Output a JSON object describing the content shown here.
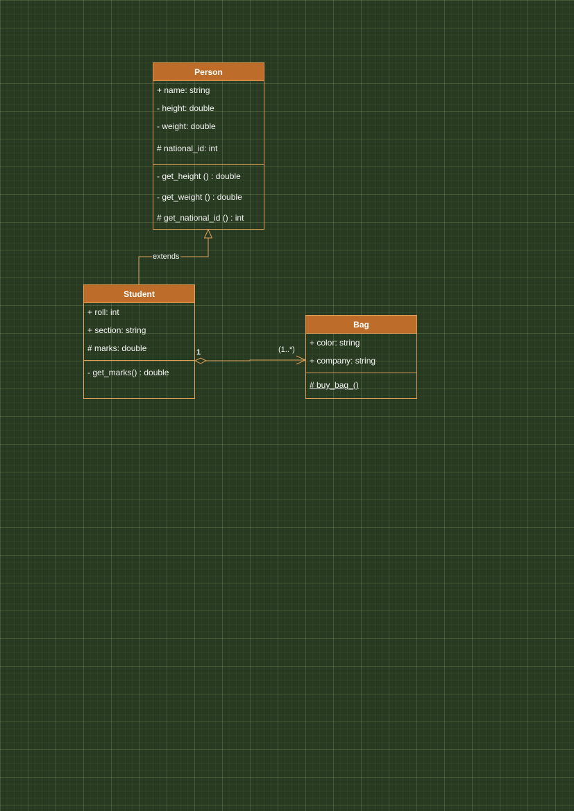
{
  "classes": {
    "person": {
      "name": "Person",
      "attributes": [
        "+ name: string",
        "- height: double",
        "- weight: double",
        "# national_id: int"
      ],
      "methods": [
        "- get_height () : double",
        "- get_weight () : double",
        "# get_national_id () : int"
      ]
    },
    "student": {
      "name": "Student",
      "attributes": [
        "+ roll: int",
        "+ section: string",
        "# marks: double"
      ],
      "methods": [
        "- get_marks() :  double"
      ]
    },
    "bag": {
      "name": "Bag",
      "attributes": [
        "+ color: string",
        "+ company: string"
      ],
      "methods": [
        "# buy_bag_()"
      ]
    }
  },
  "relations": {
    "inheritance": {
      "label": "extends"
    },
    "aggregation": {
      "source_multiplicity": "1",
      "target_multiplicity": "(1..*)"
    }
  },
  "colors": {
    "background": "#283a21",
    "header_fill": "#bd6c2a",
    "border": "#e0a15a",
    "text": "#f3f3f3"
  }
}
